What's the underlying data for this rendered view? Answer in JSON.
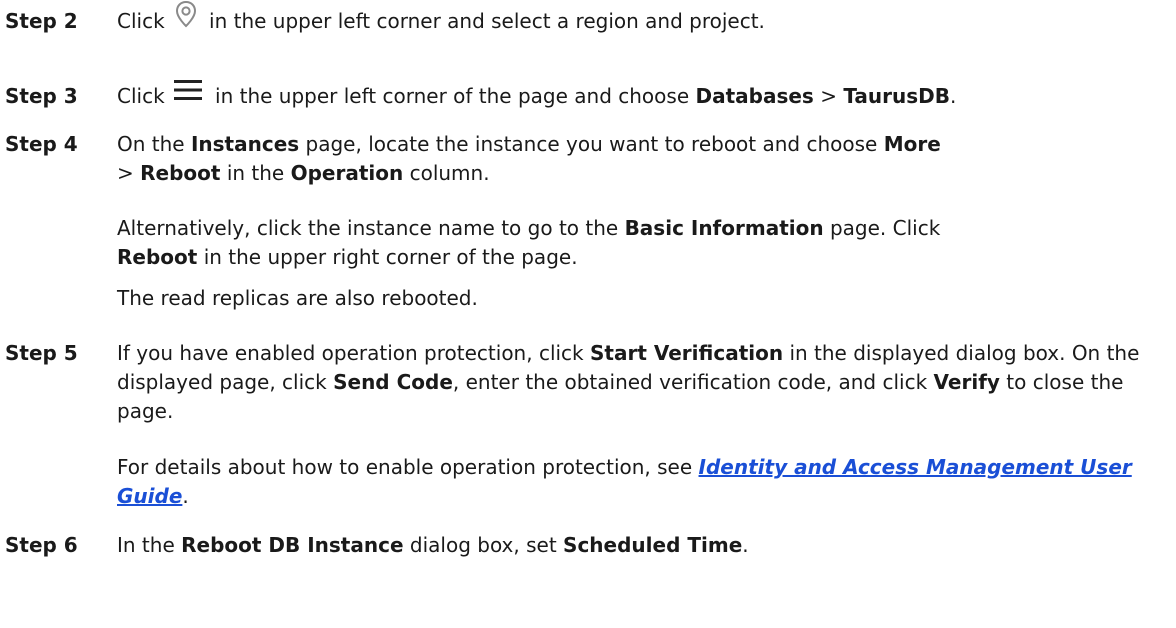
{
  "steps": {
    "s2": {
      "label": "Step 2",
      "t1": "Click",
      "icon": "location-pin-icon",
      "t2": "in the upper left corner and select a region and project."
    },
    "s3": {
      "label": "Step 3",
      "t1": "Click",
      "icon": "hamburger-menu-icon",
      "t2": "in the upper left corner of the page and choose",
      "b1": "Databases",
      "t3": ">",
      "b2": "TaurusDB",
      "t4": "."
    },
    "s4": {
      "label": "Step 4",
      "t1": "On the",
      "b1": "Instances",
      "t2": "page, locate the instance you want to reboot and choose",
      "b2": "More",
      "t3": ">",
      "b3": "Reboot",
      "t4": "in the",
      "b4": "Operation",
      "t5": "column.",
      "p1": {
        "t1": "Alternatively, click the instance name to go to the",
        "b1": "Basic Information",
        "t2": "page. Click",
        "b2": "Reboot",
        "t3": "in the upper right corner of the page."
      },
      "p2": "The read replicas are also rebooted."
    },
    "s5": {
      "label": "Step 5",
      "t1": "If you have enabled operation protection, click",
      "b1": "Start Verification",
      "t2": "in the displayed dialog box. On the displayed page, click",
      "b2": "Send Code",
      "t3": ", enter the obtained verification code, and click",
      "b3": "Verify",
      "t4": "to close the page.",
      "p1": {
        "t1": "For details about how to enable operation protection, see",
        "link": "Identity and Access Management User Guide",
        "t2": "."
      }
    },
    "s6": {
      "label": "Step 6",
      "t1": "In the",
      "b1": "Reboot DB Instance",
      "t2": "dialog box, set",
      "b2": "Scheduled Time",
      "t3": "."
    }
  },
  "colors": {
    "text": "#1a1a1a",
    "link": "#1a4fd6",
    "icon": "#8a8a8a"
  }
}
